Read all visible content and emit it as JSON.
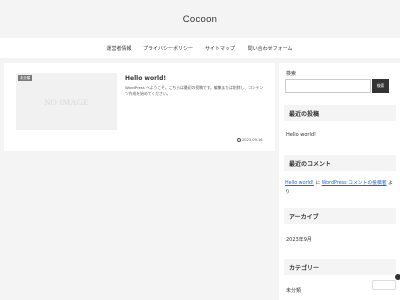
{
  "site": {
    "title": "Cocoon"
  },
  "nav": {
    "items": [
      {
        "label": "運営者情報"
      },
      {
        "label": "プライバシーポリシー"
      },
      {
        "label": "サイトマップ"
      },
      {
        "label": "問い合わせフォーム"
      }
    ]
  },
  "entry": {
    "category": "未分類",
    "thumbnail_text": "NO IMAGE",
    "title": "Hello world!",
    "snippet": "WordPress へようこそ。こちらは最初の投稿です。編集または削除し、コンテンツ作成を始めてください。",
    "date": "2023.09.16"
  },
  "sidebar": {
    "search": {
      "label": "検索",
      "placeholder": "",
      "button": "検索"
    },
    "recent_posts": {
      "title": "最近の投稿",
      "items": [
        "Hello world!"
      ]
    },
    "recent_comments": {
      "title": "最近のコメント",
      "post_link": "Hello world!",
      "connector": " に ",
      "author_link": "WordPress コメントの投稿者",
      "suffix": " より"
    },
    "archives": {
      "title": "アーカイブ",
      "items": [
        "2023年9月"
      ]
    },
    "categories": {
      "title": "カテゴリー",
      "items": [
        "未分類"
      ]
    }
  },
  "colors": {
    "background": "#f4f4f4",
    "surface": "#ffffff",
    "text": "#333333",
    "link": "#1967d2",
    "button": "#333333"
  }
}
